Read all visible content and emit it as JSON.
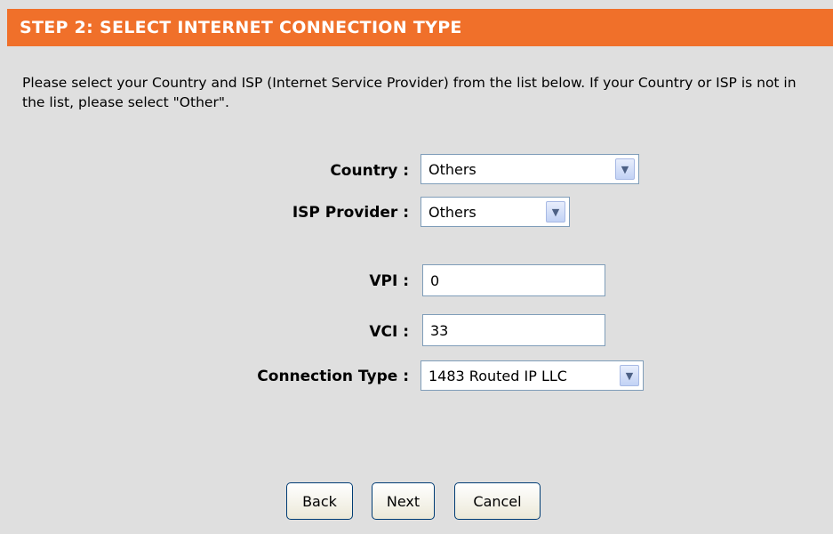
{
  "header": {
    "title": "STEP 2: SELECT INTERNET CONNECTION TYPE"
  },
  "description": "Please select your Country and ISP (Internet Service Provider) from the list below. If your Country or ISP is not in the list, please select \"Other\".",
  "form": {
    "country": {
      "label": "Country :",
      "value": "Others"
    },
    "isp": {
      "label": "ISP Provider :",
      "value": "Others"
    },
    "vpi": {
      "label": "VPI :",
      "value": "0"
    },
    "vci": {
      "label": "VCI :",
      "value": "33"
    },
    "connection_type": {
      "label": "Connection Type :",
      "value": "1483 Routed IP LLC"
    }
  },
  "buttons": {
    "back": "Back",
    "next": "Next",
    "cancel": "Cancel"
  },
  "colors": {
    "header_bg": "#f0702a",
    "page_bg": "#dfdfdf"
  }
}
